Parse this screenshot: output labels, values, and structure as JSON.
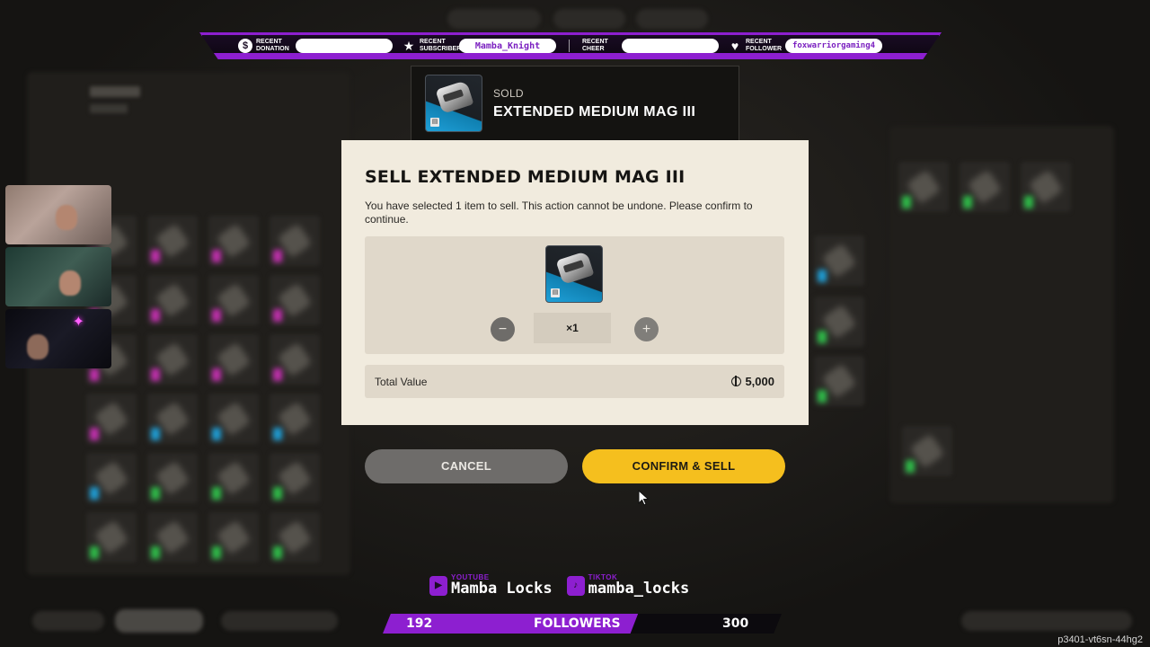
{
  "overlay": {
    "top_bar": {
      "donation_label": "RECENT DONATION",
      "donation_value": "",
      "subscriber_label": "RECENT SUBSCRIBER",
      "subscriber_value": "Mamba_Knight",
      "cheer_label": "RECENT CHEER",
      "cheer_value": "",
      "follower_label": "RECENT FOLLOWER",
      "follower_value": "foxwarriorgaming4"
    },
    "socials": [
      {
        "platform": "YOUTUBE",
        "handle": "Mamba Locks"
      },
      {
        "platform": "TIKTOK",
        "handle": "mamba_locks"
      }
    ],
    "followers_goal": {
      "current": "192",
      "label": "FOLLOWERS",
      "goal": "300",
      "progress": 0.64
    },
    "watermark": "p3401-vt6sn-44hg2"
  },
  "toast": {
    "status": "SOLD",
    "item_name": "EXTENDED MEDIUM MAG III"
  },
  "dialog": {
    "title": "SELL EXTENDED MEDIUM MAG III",
    "message": "You have selected 1 item to sell. This action cannot be undone. Please confirm to continue.",
    "quantity": "×1",
    "total_label": "Total Value",
    "total_value": "5,000"
  },
  "buttons": {
    "cancel": "CANCEL",
    "confirm": "CONFIRM & SELL"
  },
  "colors": {
    "accent_purple": "#8d1fd0",
    "confirm_yellow": "#f5bf1e",
    "dialog_bg": "#f1ebde"
  },
  "icons": {
    "donation": "dollar-coin-icon",
    "subscriber": "star-icon",
    "follower": "heart-icon",
    "currency": "coin-icon"
  }
}
